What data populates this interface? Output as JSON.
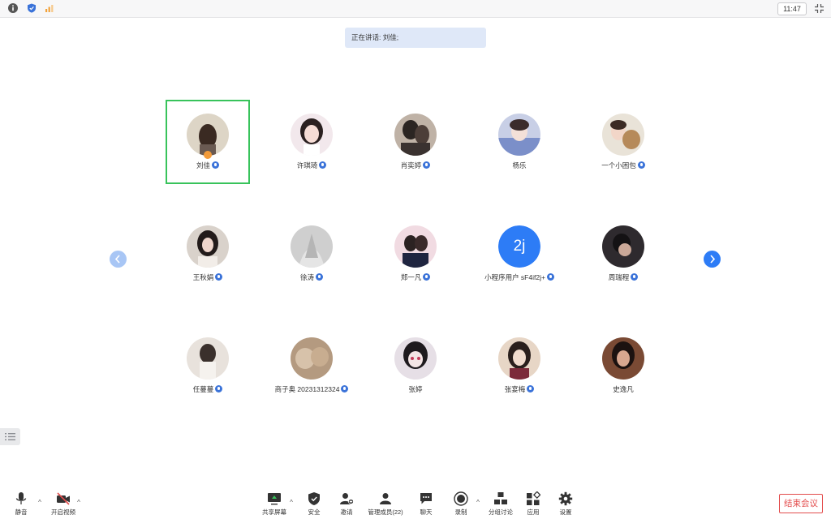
{
  "status_bar": {
    "time": "11:47",
    "icons": [
      "info-icon",
      "shield-icon",
      "signal-icon",
      "fullscreen-exit-icon"
    ]
  },
  "speaker": {
    "text": "正在讲话: 刘佳;"
  },
  "participants": [
    {
      "name": "刘佳",
      "mic": true,
      "active": true
    },
    {
      "name": "许琪琦",
      "mic": true
    },
    {
      "name": "肖奕婷",
      "mic": true
    },
    {
      "name": "杨乐",
      "mic": false
    },
    {
      "name": "一个小困包",
      "mic": true
    },
    {
      "name": "王秋娟",
      "mic": true
    },
    {
      "name": "徐涛",
      "mic": true
    },
    {
      "name": "郑一凡",
      "mic": true
    },
    {
      "name": "小程序用户 sF4if2j+",
      "mic": true,
      "initials": "2j"
    },
    {
      "name": "周瑞程",
      "mic": true
    },
    {
      "name": "任蔓蔓",
      "mic": true
    },
    {
      "name": "商子奥 20231312324",
      "mic": true
    },
    {
      "name": "张婷",
      "mic": false
    },
    {
      "name": "张宴梅",
      "mic": true
    },
    {
      "name": "史逸凡",
      "mic": false
    }
  ],
  "toolbar": {
    "mute": "静音",
    "video": "开启视频",
    "share": "共享屏幕",
    "security": "安全",
    "invite": "邀请",
    "members": "管理成员(22)",
    "chat": "聊天",
    "record": "录制",
    "breakout": "分组讨论",
    "apps": "应用",
    "settings": "设置",
    "end": "结束会议"
  },
  "colors": {
    "accent": "#2d7cf6",
    "active_border": "#38c35b",
    "end": "#e34d4d",
    "banner": "#dfe8f8"
  }
}
